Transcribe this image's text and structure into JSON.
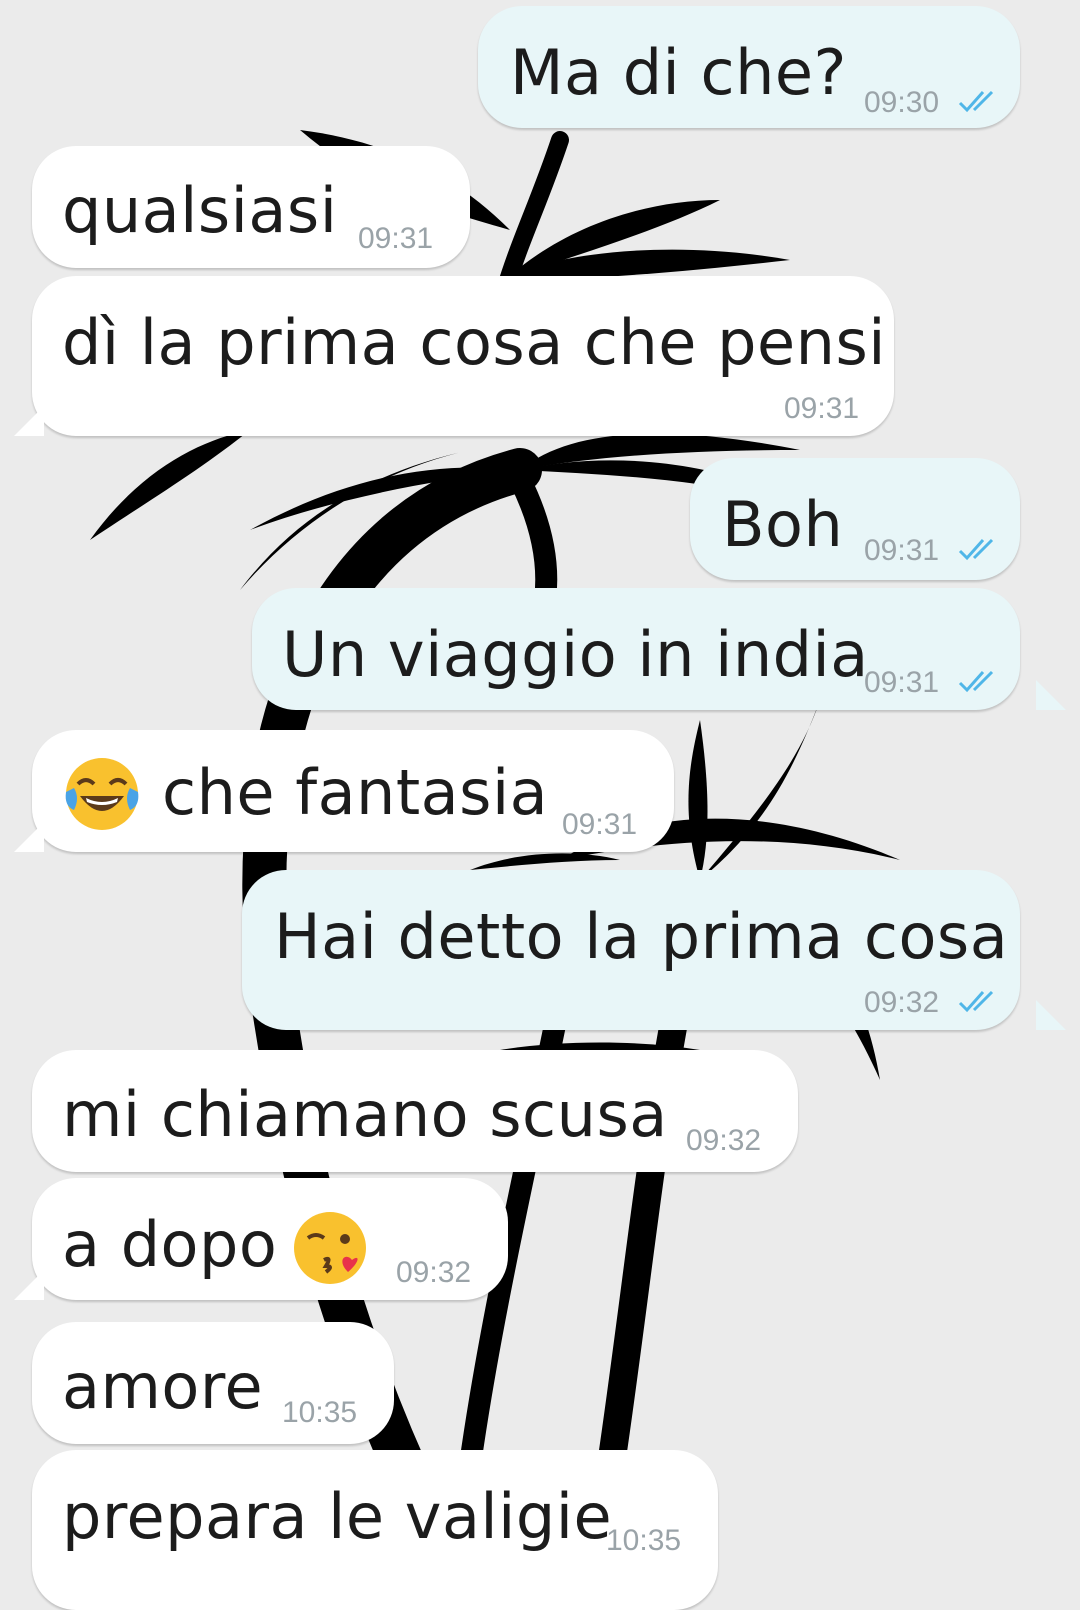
{
  "conversation": {
    "messages": [
      {
        "direction": "out",
        "text": "Ma di che?",
        "time": "09:30",
        "status": "read"
      },
      {
        "direction": "in",
        "text": "qualsiasi",
        "time": "09:31"
      },
      {
        "direction": "in",
        "text": "dì la prima cosa che pensi",
        "time": "09:31"
      },
      {
        "direction": "out",
        "text": "Boh",
        "time": "09:31",
        "status": "read"
      },
      {
        "direction": "out",
        "text": "Un viaggio in india",
        "time": "09:31",
        "status": "read"
      },
      {
        "direction": "in",
        "emoji": "face-with-tears-of-joy",
        "text": "che fantasia",
        "time": "09:31"
      },
      {
        "direction": "out",
        "text": "Hai detto la prima cosa",
        "time": "09:32",
        "status": "read"
      },
      {
        "direction": "in",
        "text": "mi chiamano scusa",
        "time": "09:32"
      },
      {
        "direction": "in",
        "text": "a dopo",
        "emoji_after": "face-blowing-a-kiss",
        "time": "09:32"
      },
      {
        "direction": "in",
        "text": "amore",
        "time": "10:35"
      },
      {
        "direction": "in",
        "text": "prepara le valigie",
        "time": "10:35"
      }
    ]
  },
  "colors": {
    "background": "#ebebeb",
    "incoming_bubble": "#ffffff",
    "outgoing_bubble": "#e8f6f8",
    "read_ticks": "#4fb6e8",
    "timestamp": "#9aa3a8",
    "wallpaper_silhouette": "#000000"
  }
}
